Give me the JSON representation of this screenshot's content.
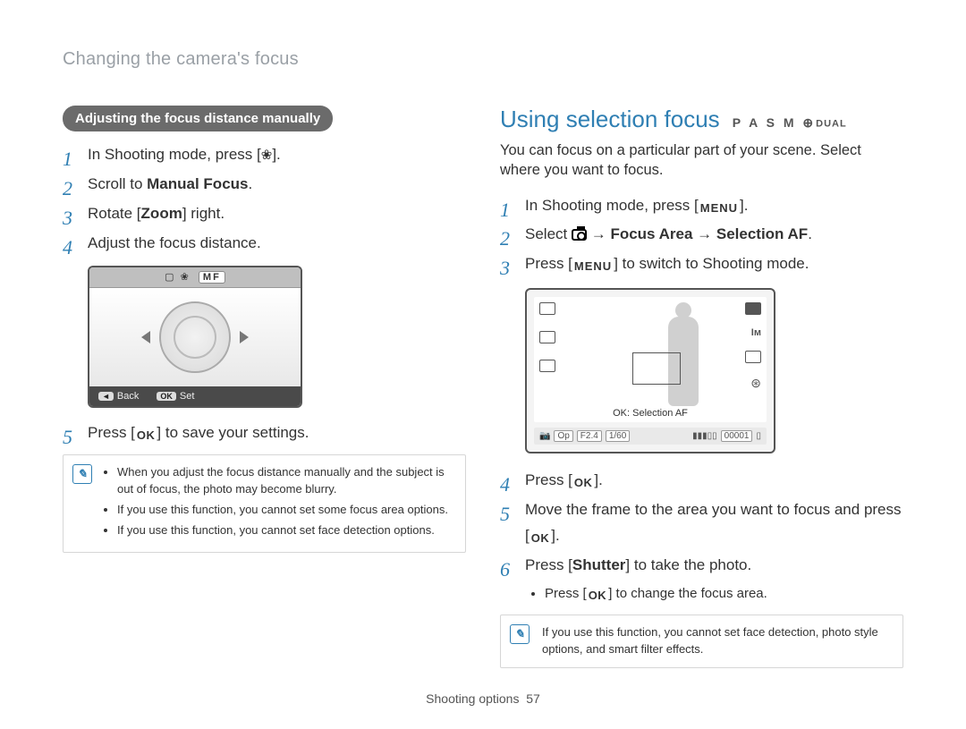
{
  "breadcrumb": "Changing the camera's focus",
  "left": {
    "pill": "Adjusting the focus distance manually",
    "steps": {
      "s1_pre": "In Shooting mode, press [",
      "s1_post": "].",
      "s2_pre": "Scroll to ",
      "s2_bold": "Manual Focus",
      "s2_post": ".",
      "s3_pre": "Rotate [",
      "s3_bold": "Zoom",
      "s3_post": "] right.",
      "s4": "Adjust the focus distance.",
      "s5_pre": "Press [",
      "s5_post": "] to save your settings."
    },
    "fig": {
      "topbar_mf": "MF",
      "back_chip": "◄",
      "back": "Back",
      "ok_chip": "OK",
      "set": "Set"
    },
    "note": {
      "b1": "When you adjust the focus distance manually and the subject is out of focus, the photo may become blurry.",
      "b2": "If you use this function, you cannot set some focus area options.",
      "b3": "If you use this function, you cannot set face detection options."
    }
  },
  "right": {
    "title": "Using selection focus",
    "modes": "P A S M",
    "modes_small": "DUAL",
    "intro": "You can focus on a particular part of your scene. Select where you want to focus.",
    "steps": {
      "s1_pre": "In Shooting mode, press [",
      "s1_post": "].",
      "s2_pre": "Select ",
      "s2_arrow1": " → ",
      "s2_bold1": "Focus Area",
      "s2_arrow2": " → ",
      "s2_bold2": "Selection AF",
      "s2_post": ".",
      "s3_pre": "Press [",
      "s3_post": "] to switch to Shooting mode.",
      "s4_pre": "Press [",
      "s4_post": "].",
      "s5_pre": "Move the frame to the area you want to focus and press [",
      "s5_post": "].",
      "s6_pre": "Press [",
      "s6_bold": "Shutter",
      "s6_post": "] to take the photo.",
      "s6_sub_pre": "Press [",
      "s6_sub_post": "] to change the focus area."
    },
    "fig": {
      "ok_label": "OK: Selection AF",
      "mode_chip": "Op",
      "f": "F2.4",
      "sh": "1/60",
      "counter": "00001"
    },
    "note": "If you use this function, you cannot set face detection, photo style options, and smart filter effects."
  },
  "labels": {
    "ok": "OK",
    "menu": "MENU"
  },
  "footer": {
    "section": "Shooting options",
    "page": "57"
  }
}
